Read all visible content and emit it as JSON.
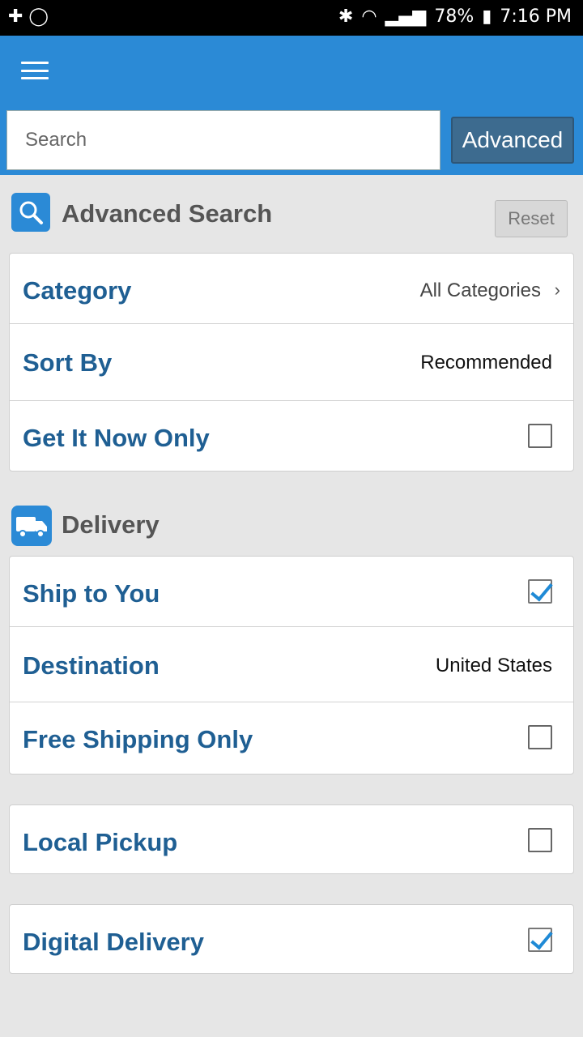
{
  "status_bar": {
    "battery": "78%",
    "time": "7:16 PM"
  },
  "search": {
    "placeholder": "Search",
    "value": ""
  },
  "header": {
    "advanced_button": "Advanced"
  },
  "advanced": {
    "title": "Advanced Search",
    "reset_button": "Reset"
  },
  "filters": {
    "category_label": "Category",
    "category_value": "All Categories",
    "sort_label": "Sort By",
    "sort_value": "Recommended",
    "get_it_now_label": "Get It Now Only",
    "get_it_now_checked": false
  },
  "delivery": {
    "title": "Delivery",
    "ship_to_you_label": "Ship to You",
    "ship_to_you_checked": true,
    "destination_label": "Destination",
    "destination_value": "United States",
    "free_shipping_label": "Free Shipping Only",
    "free_shipping_checked": false
  },
  "local_pickup": {
    "label": "Local Pickup",
    "checked": false
  },
  "digital_delivery": {
    "label": "Digital Delivery",
    "checked": true
  },
  "colors": {
    "appbar": "#2b8ad6",
    "label_blue": "#1f5f93",
    "button_dark": "#3d6b8f",
    "check_blue": "#1f8ad6"
  }
}
